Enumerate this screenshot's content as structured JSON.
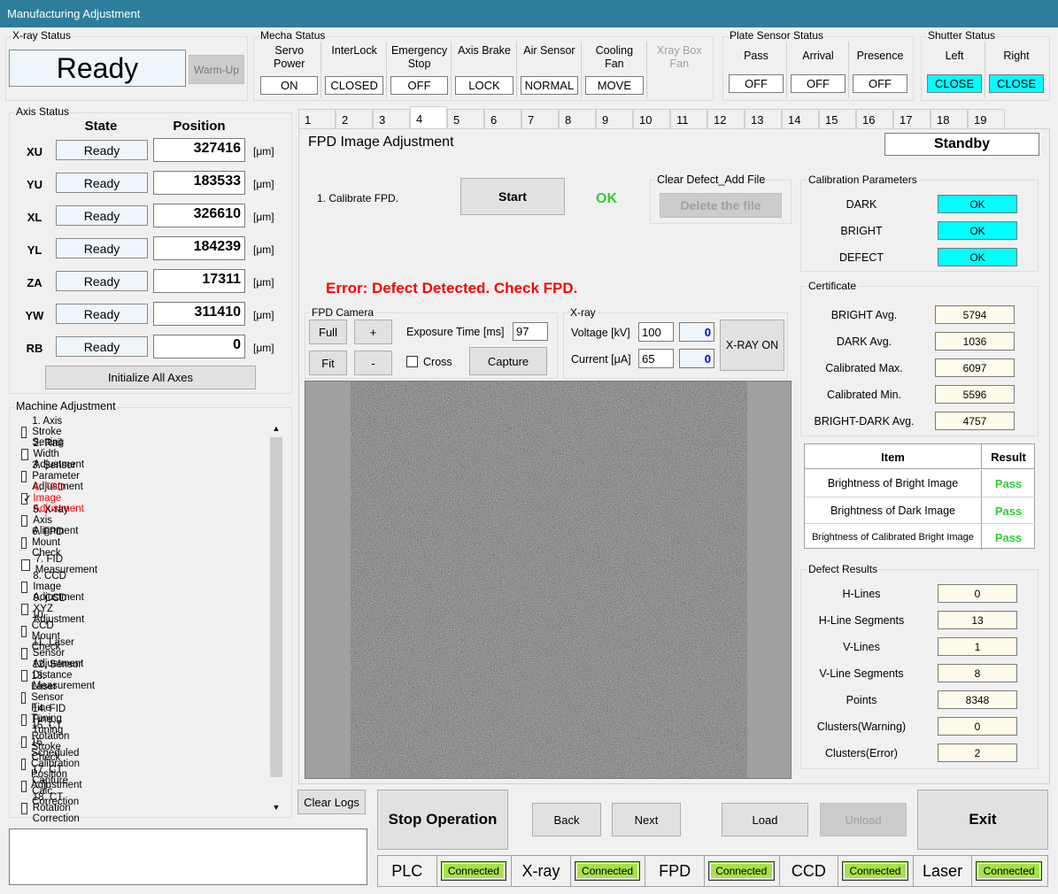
{
  "window": {
    "title": "Manufacturing Adjustment"
  },
  "xray_status": {
    "label": "X-ray Status",
    "value": "Ready",
    "warmup": "Warm-Up"
  },
  "mecha": {
    "label": "Mecha Status",
    "items": [
      {
        "name": "Servo\nPower",
        "value": "ON"
      },
      {
        "name": "InterLock",
        "value": "CLOSED"
      },
      {
        "name": "Emergency\nStop",
        "value": "OFF"
      },
      {
        "name": "Axis Brake",
        "value": "LOCK"
      },
      {
        "name": "Air Sensor",
        "value": "NORMAL"
      },
      {
        "name": "Cooling\nFan",
        "value": "MOVE"
      },
      {
        "name": "Xray Box\nFan",
        "value": ""
      }
    ]
  },
  "plate": {
    "label": "Plate Sensor Status",
    "items": [
      {
        "name": "Pass",
        "value": "OFF"
      },
      {
        "name": "Arrival",
        "value": "OFF"
      },
      {
        "name": "Presence",
        "value": "OFF"
      }
    ]
  },
  "shutter": {
    "label": "Shutter Status",
    "items": [
      {
        "name": "Left",
        "value": "CLOSE"
      },
      {
        "name": "Right",
        "value": "CLOSE"
      }
    ]
  },
  "axis": {
    "label": "Axis Status",
    "state_header": "State",
    "position_header": "Position",
    "unit": "[μm]",
    "rows": [
      {
        "axis": "XU",
        "state": "Ready",
        "pos": "327416"
      },
      {
        "axis": "YU",
        "state": "Ready",
        "pos": "183533"
      },
      {
        "axis": "XL",
        "state": "Ready",
        "pos": "326610"
      },
      {
        "axis": "YL",
        "state": "Ready",
        "pos": "184239"
      },
      {
        "axis": "ZA",
        "state": "Ready",
        "pos": "17311"
      },
      {
        "axis": "YW",
        "state": "Ready",
        "pos": "311410"
      },
      {
        "axis": "RB",
        "state": "Ready",
        "pos": "0"
      }
    ],
    "init_button": "Initialize All Axes"
  },
  "machine": {
    "label": "Machine Adjustment",
    "items": [
      {
        "text": "1. Axis Stroke Setting",
        "checked": false
      },
      {
        "text": "2. Rail Width Adjustment",
        "checked": false
      },
      {
        "text": "3. Sensor Parameter Adjustment",
        "checked": false
      },
      {
        "text": "4. FPD Image Adjustment",
        "checked": true
      },
      {
        "text": "5. X-ray Axis Alignment",
        "checked": false
      },
      {
        "text": "6. FPD Mount Check",
        "checked": false
      },
      {
        "text": "7. FID Measurement",
        "checked": false
      },
      {
        "text": "8. CCD Image Adjustment",
        "checked": false
      },
      {
        "text": "9. CCD XYZ Adjustment",
        "checked": false
      },
      {
        "text": "10. CCD Mount Check",
        "checked": false
      },
      {
        "text": "11. Laser Sensor Adjustment",
        "checked": false
      },
      {
        "text": "12. Sensor Distance Measurement",
        "checked": false
      },
      {
        "text": "13. Laser Sensor Fine Tuning",
        "checked": false
      },
      {
        "text": "14. FID Fine Tuning",
        "checked": false
      },
      {
        "text": "15. CT Rotation Stroke Check",
        "checked": false
      },
      {
        "text": "16. Scheduled Calibration Position Adjustment",
        "checked": false
      },
      {
        "text": "17. CT Capture Calc Correction",
        "checked": false
      },
      {
        "text": "18. CT Rotation Correction",
        "checked": false
      }
    ]
  },
  "tabs": [
    "1",
    "2",
    "3",
    "4",
    "5",
    "6",
    "7",
    "8",
    "9",
    "10",
    "11",
    "12",
    "13",
    "14",
    "15",
    "16",
    "17",
    "18",
    "19"
  ],
  "fpd": {
    "title": "FPD Image Adjustment",
    "standby": "Standby",
    "step": "1. Calibrate FPD.",
    "start": "Start",
    "ok": "OK",
    "clear_label": "Clear Defect_Add File",
    "delete_btn": "Delete the file",
    "error": "Error: Defect Detected. Check FPD.",
    "camera_label": "FPD Camera",
    "full": "Full",
    "plus": "+",
    "fit": "Fit",
    "minus": "-",
    "exposure_label": "Exposure Time [ms]",
    "exposure": "97",
    "cross": "Cross",
    "capture": "Capture",
    "xray_label": "X-ray",
    "voltage_label": "Voltage [kV]",
    "voltage": "100",
    "voltage_read": "0",
    "current_label": "Current [μA]",
    "current": "65",
    "current_read": "0",
    "xray_on": "X-RAY ON"
  },
  "calib": {
    "label": "Calibration Parameters",
    "items": [
      {
        "name": "DARK",
        "value": "OK"
      },
      {
        "name": "BRIGHT",
        "value": "OK"
      },
      {
        "name": "DEFECT",
        "value": "OK"
      }
    ]
  },
  "cert": {
    "label": "Certificate",
    "items": [
      {
        "name": "BRIGHT Avg.",
        "value": "5794"
      },
      {
        "name": "DARK Avg.",
        "value": "1036"
      },
      {
        "name": "Calibrated Max.",
        "value": "6097"
      },
      {
        "name": "Calibrated Min.",
        "value": "5596"
      },
      {
        "name": "BRIGHT-DARK Avg.",
        "value": "4757"
      }
    ]
  },
  "result_table": {
    "item_header": "Item",
    "result_header": "Result",
    "rows": [
      {
        "item": "Brightness of Bright Image",
        "result": "Pass"
      },
      {
        "item": "Brightness of Dark Image",
        "result": "Pass"
      },
      {
        "item": "Brightness of Calibrated Bright Image",
        "result": "Pass"
      }
    ]
  },
  "defects": {
    "label": "Defect Results",
    "items": [
      {
        "name": "H-Lines",
        "value": "0"
      },
      {
        "name": "H-Line Segments",
        "value": "13"
      },
      {
        "name": "V-Lines",
        "value": "1"
      },
      {
        "name": "V-Line Segments",
        "value": "8"
      },
      {
        "name": "Points",
        "value": "8348"
      },
      {
        "name": "Clusters(Warning)",
        "value": "0"
      },
      {
        "name": "Clusters(Error)",
        "value": "2"
      }
    ]
  },
  "bottom": {
    "clear_logs": "Clear Logs",
    "stop": "Stop Operation",
    "back": "Back",
    "next": "Next",
    "load": "Load",
    "unload": "Unload",
    "exit": "Exit"
  },
  "connections": [
    {
      "name": "PLC",
      "status": "Connected"
    },
    {
      "name": "X-ray",
      "status": "Connected"
    },
    {
      "name": "FPD",
      "status": "Connected"
    },
    {
      "name": "CCD",
      "status": "Connected"
    },
    {
      "name": "Laser",
      "status": "Connected"
    }
  ],
  "colors": {
    "title_bar": "#2e7d9c",
    "cyan": "#00ffff",
    "connected": "#a4e14e",
    "error": "#ff0000",
    "ok": "#33cc33",
    "pass": "#33cc33",
    "active_item": "#ff0000",
    "readback": "#0000cc"
  }
}
